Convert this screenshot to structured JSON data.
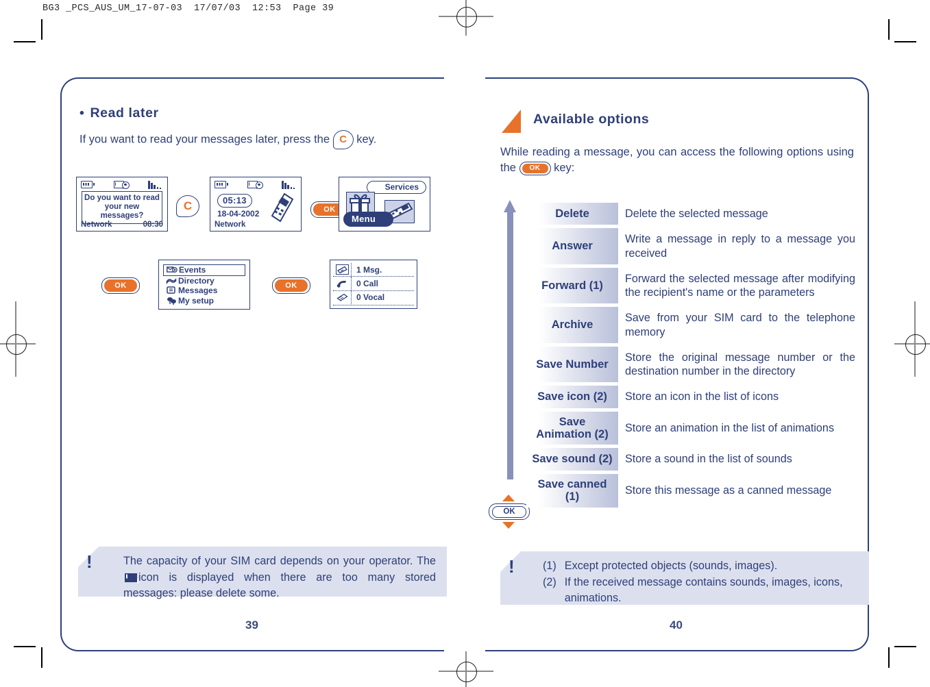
{
  "print_header": "BG3 _PCS_AUS_UM_17-07-03  17/07/03  12:53  Page 39",
  "colors": {
    "brand_blue": "#2e3f79",
    "accent_orange": "#e8722a",
    "note_bg": "#dce0ee",
    "arrow_blue": "#8891bb",
    "label_gradient_end": "#b9c0d9"
  },
  "left_page": {
    "page_number": "39",
    "heading_bullet": "•",
    "heading": "Read later",
    "intro_before": "If you want to read your messages later, press the",
    "intro_key": "C",
    "intro_after": "key.",
    "screens": {
      "prompt": {
        "message": "Do you want to read your new messages?",
        "soft_left": "Network",
        "soft_right": "08:30",
        "icons": [
          "battery-icon",
          "message-eye-icon",
          "signal-bars-icon"
        ]
      },
      "idle": {
        "clock": "05:13",
        "date": "18-04-2002",
        "network": "Network",
        "icons": [
          "battery-icon",
          "message-eye-icon",
          "signal-bars-icon",
          "handset-icon"
        ]
      },
      "services": {
        "title": "Services",
        "menu_label": "Menu",
        "icons": [
          "gift-icon",
          "handset-icon"
        ]
      },
      "main_menu": {
        "items": [
          {
            "label": "Events",
            "icon": "message-eye-icon",
            "selected": true
          },
          {
            "label": "Directory",
            "icon": "directory-icon",
            "selected": false
          },
          {
            "label": "Messages",
            "icon": "messages-icon",
            "selected": false
          },
          {
            "label": "My setup",
            "icon": "my-setup-icon",
            "selected": false
          }
        ]
      },
      "events": {
        "rows": [
          {
            "label": "1 Msg.",
            "icon": "message-icon"
          },
          {
            "label": "0 Call",
            "icon": "phone-icon"
          },
          {
            "label": "0 Vocal",
            "icon": "voicemail-icon"
          }
        ]
      }
    },
    "keys": {
      "c_key": "C",
      "ok_key_1": "OK",
      "ok_key_2": "OK",
      "ok_key_3": "OK"
    },
    "note": {
      "marker": "!",
      "line1": "The capacity of your SIM card depends on your operator. The",
      "icon": "full-mailbox-icon",
      "line2": "icon is displayed when there are too many stored messages: please delete some."
    }
  },
  "right_page": {
    "page_number": "40",
    "section_title": "Available options",
    "intro_before": "While reading a message, you can access the following options using the",
    "intro_key": "OK",
    "intro_after": "key:",
    "nav_key_label": "OK",
    "options": [
      {
        "label": "Delete",
        "desc": "Delete the selected message"
      },
      {
        "label": "Answer",
        "desc": "Write a message in reply to a message you received"
      },
      {
        "label": "Forward (1)",
        "desc": "Forward the selected message after modifying the recipient's name or the parameters"
      },
      {
        "label": "Archive",
        "desc": "Save from your SIM card to the telephone memory"
      },
      {
        "label": "Save Number",
        "desc": "Store the original message number or the destination number in the directory"
      },
      {
        "label": "Save icon (2)",
        "desc": "Store an icon in the list of icons"
      },
      {
        "label": "Save Animation (2)",
        "desc": "Store an animation in the list of animations"
      },
      {
        "label": "Save sound (2)",
        "desc": "Store a sound in the list of sounds"
      },
      {
        "label": "Save canned (1)",
        "desc": "Store this message as a canned message"
      }
    ],
    "footnotes": {
      "marker": "!",
      "items": [
        {
          "num": "(1)",
          "text": "Except protected objects (sounds, images)."
        },
        {
          "num": "(2)",
          "text": "If the received message contains sounds, images, icons, animations."
        }
      ]
    }
  }
}
